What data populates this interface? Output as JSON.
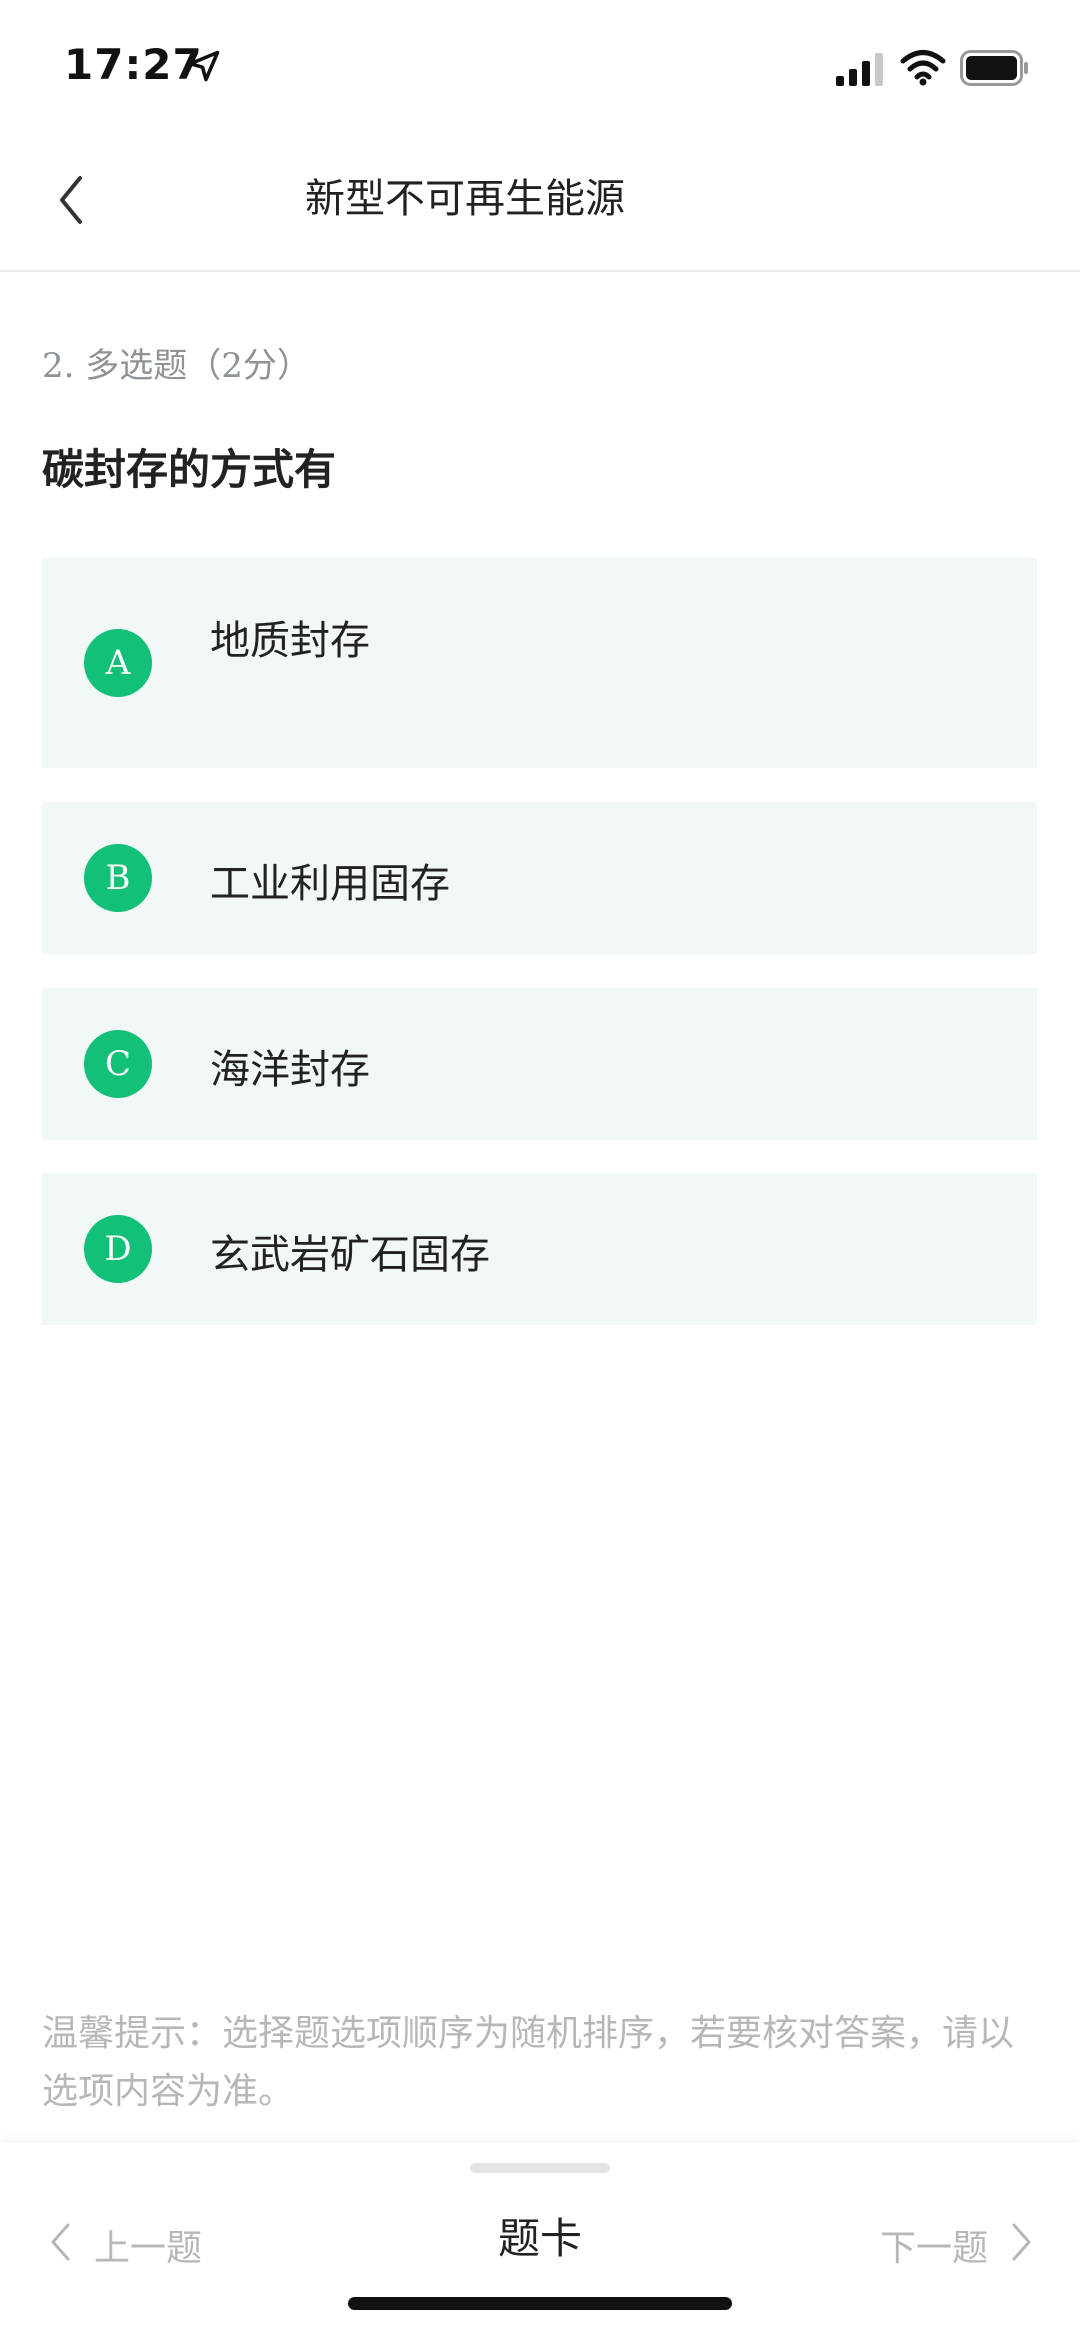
{
  "status_bar": {
    "time": "17:27",
    "icons": [
      "location-arrow-icon",
      "signal-icon",
      "wifi-icon",
      "battery-icon"
    ]
  },
  "nav": {
    "title": "新型不可再生能源",
    "back_icon": "chevron-left-icon"
  },
  "question": {
    "meta": "2. 多选题（2分）",
    "title": "碳封存的方式有"
  },
  "options": [
    {
      "letter": "A",
      "text": "地质封存"
    },
    {
      "letter": "B",
      "text": "工业利用固存"
    },
    {
      "letter": "C",
      "text": "海洋封存"
    },
    {
      "letter": "D",
      "text": "玄武岩矿石固存"
    }
  ],
  "tip": "温馨提示：选择题选项顺序为随机排序，若要核对答案，请以选项内容为准。",
  "bottom_bar": {
    "prev_label": "上一题",
    "card_label": "题卡",
    "next_label": "下一题"
  },
  "colors": {
    "accent": "#12c078",
    "option_bg": "#f2f7f7",
    "muted_text": "#b5b8ba"
  }
}
